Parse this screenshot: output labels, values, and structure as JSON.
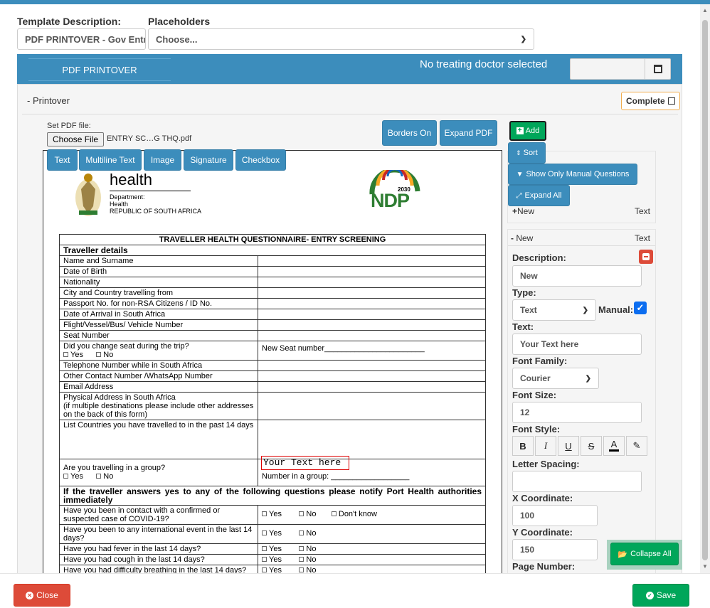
{
  "header": {
    "template_label": "Template Description:",
    "template_value": "PDF PRINTOVER - Gov Entry",
    "placeholders_label": "Placeholders",
    "placeholders_value": "Choose..."
  },
  "banner": {
    "tab_label": "PDF PRINTOVER",
    "status": "No treating doctor selected",
    "date_value": ""
  },
  "printover": {
    "title": "Printover",
    "complete_label": "Complete",
    "set_file_label": "Set PDF file:",
    "choose_file_label": "Choose File",
    "file_name": "ENTRY SC…G THQ.pdf",
    "borders_label": "Borders On",
    "expand_pdf_label": "Expand PDF",
    "tools": [
      "Text",
      "Multiline Text",
      "Image",
      "Signature",
      "Checkbox"
    ]
  },
  "pdf": {
    "health": "health",
    "dept_lines": [
      "Department:",
      "Health",
      "REPUBLIC OF SOUTH AFRICA"
    ],
    "ndp": "NDP",
    "ndp_year": "2030",
    "form_title": "TRAVELLER HEALTH QUESTIONNAIRE- ENTRY SCREENING",
    "section1": "Traveller details",
    "rows": [
      "Name and Surname",
      "Date of Birth",
      "Nationality",
      "City and Country travelling from",
      "Passport No. for non-RSA Citizens / ID No.",
      "Date of Arrival in South Africa",
      "Flight/Vessel/Bus/ Vehicle Number",
      "Seat Number"
    ],
    "seat_change_q": "Did you change seat during the trip?",
    "yes": "Yes",
    "no": "No",
    "dont_know": "Don't know",
    "new_seat": "New Seat number_______________________",
    "rows2": [
      "Telephone Number while in South Africa",
      "Other Contact Number /WhatsApp Number",
      "Email Address"
    ],
    "physical_address": "Physical Address in South Africa",
    "physical_note": "(if multiple destinations please include other addresses on the back of this form)",
    "countries_q": "List Countries you have travelled to in the past 14 days",
    "group_q": "Are you travelling in a group?",
    "overlay_text": "Your Text here",
    "group_number": "Number in a group: __________________",
    "section2": "If the traveller answers yes to any of the following questions please notify Port Health authorities immediately",
    "q_covid": "Have you been in contact with a confirmed or suspected case of COVID-19?",
    "q_event": "Have you been to any international event in the last 14 days?",
    "q_fever": "Have you had fever in the last 14 days?",
    "q_cough": "Have you had cough in the last 14 days?",
    "q_breath": "Have you had difficulty breathing in the last 14 days?"
  },
  "sidebar": {
    "add_label": "Add",
    "sort_label": "Sort",
    "manual_label": "Show Only Manual Questions",
    "expand_all_label": "Expand All",
    "item1_name": "New",
    "item1_type": "Text",
    "item2_name": "New",
    "item2_type": "Text",
    "description_label": "Description:",
    "description_value": "New",
    "type_label": "Type:",
    "type_value": "Text",
    "manual_field_label": "Manual:",
    "text_label": "Text:",
    "text_value": "Your Text here",
    "font_family_label": "Font Family:",
    "font_family_value": "Courier",
    "font_size_label": "Font Size:",
    "font_size_value": "12",
    "font_style_label": "Font Style:",
    "letter_spacing_label": "Letter Spacing:",
    "letter_spacing_value": "",
    "x_label": "X Coordinate:",
    "x_value": "100",
    "y_label": "Y Coordinate:",
    "y_value": "150",
    "page_label": "Page Number:",
    "collapse_all_label": "Collapse All"
  },
  "footer": {
    "close_label": "Close",
    "save_label": "Save"
  },
  "colors": {
    "primary": "#3c8dbc",
    "danger": "#dd4b39",
    "success": "#00a65a",
    "warning": "#f0ad4e"
  }
}
